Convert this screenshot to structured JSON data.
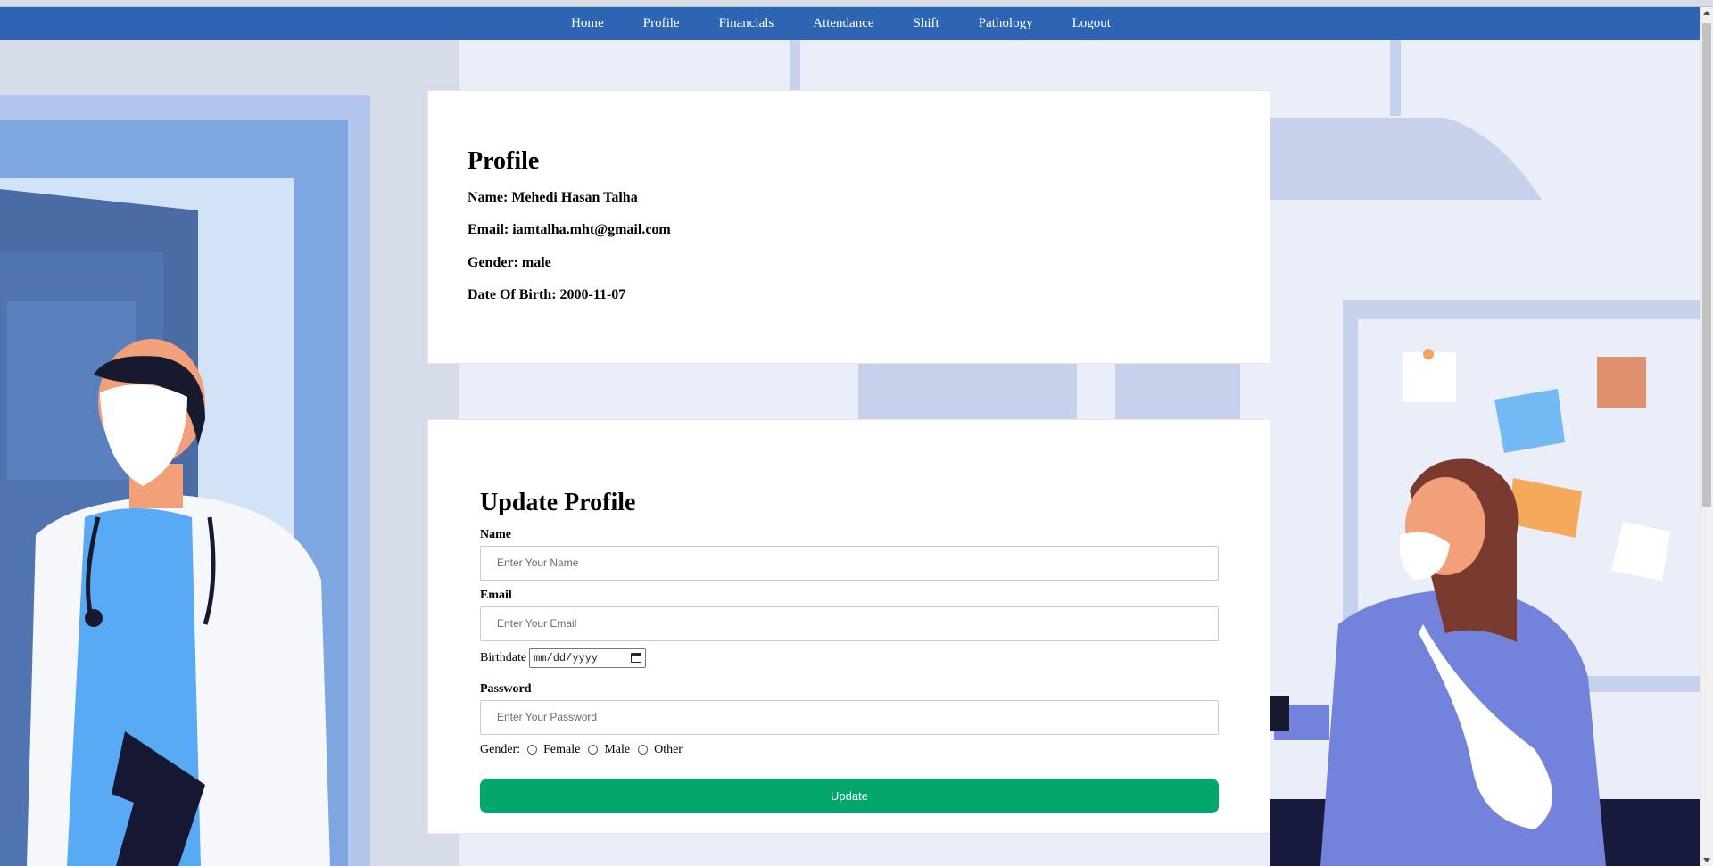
{
  "nav": {
    "items": [
      "Home",
      "Profile",
      "Financials",
      "Attendance",
      "Shift",
      "Pathology",
      "Logout"
    ]
  },
  "profile": {
    "title": "Profile",
    "name_label": "Name:",
    "name_value": "Mehedi Hasan Talha",
    "email_label": "Email:",
    "email_value": "iamtalha.mht@gmail.com",
    "gender_label": "Gender:",
    "gender_value": "male",
    "dob_label": "Date Of Birth:",
    "dob_value": "2000-11-07"
  },
  "update_form": {
    "title": "Update Profile",
    "name_label": "Name",
    "name_placeholder": "Enter Your Name",
    "email_label": "Email",
    "email_placeholder": "Enter Your Email",
    "birthdate_label": "Birthdate",
    "birthdate_placeholder": "mm/dd/yyyy",
    "password_label": "Password",
    "password_placeholder": "Enter Your Password",
    "gender_label": "Gender:",
    "gender_options": [
      "Female",
      "Male",
      "Other"
    ],
    "submit_label": "Update"
  },
  "colors": {
    "navbar": "#2d65b4",
    "update_button": "#03a76b",
    "background": "#e9eef8"
  },
  "icons": {
    "calendar": "calendar-icon"
  }
}
